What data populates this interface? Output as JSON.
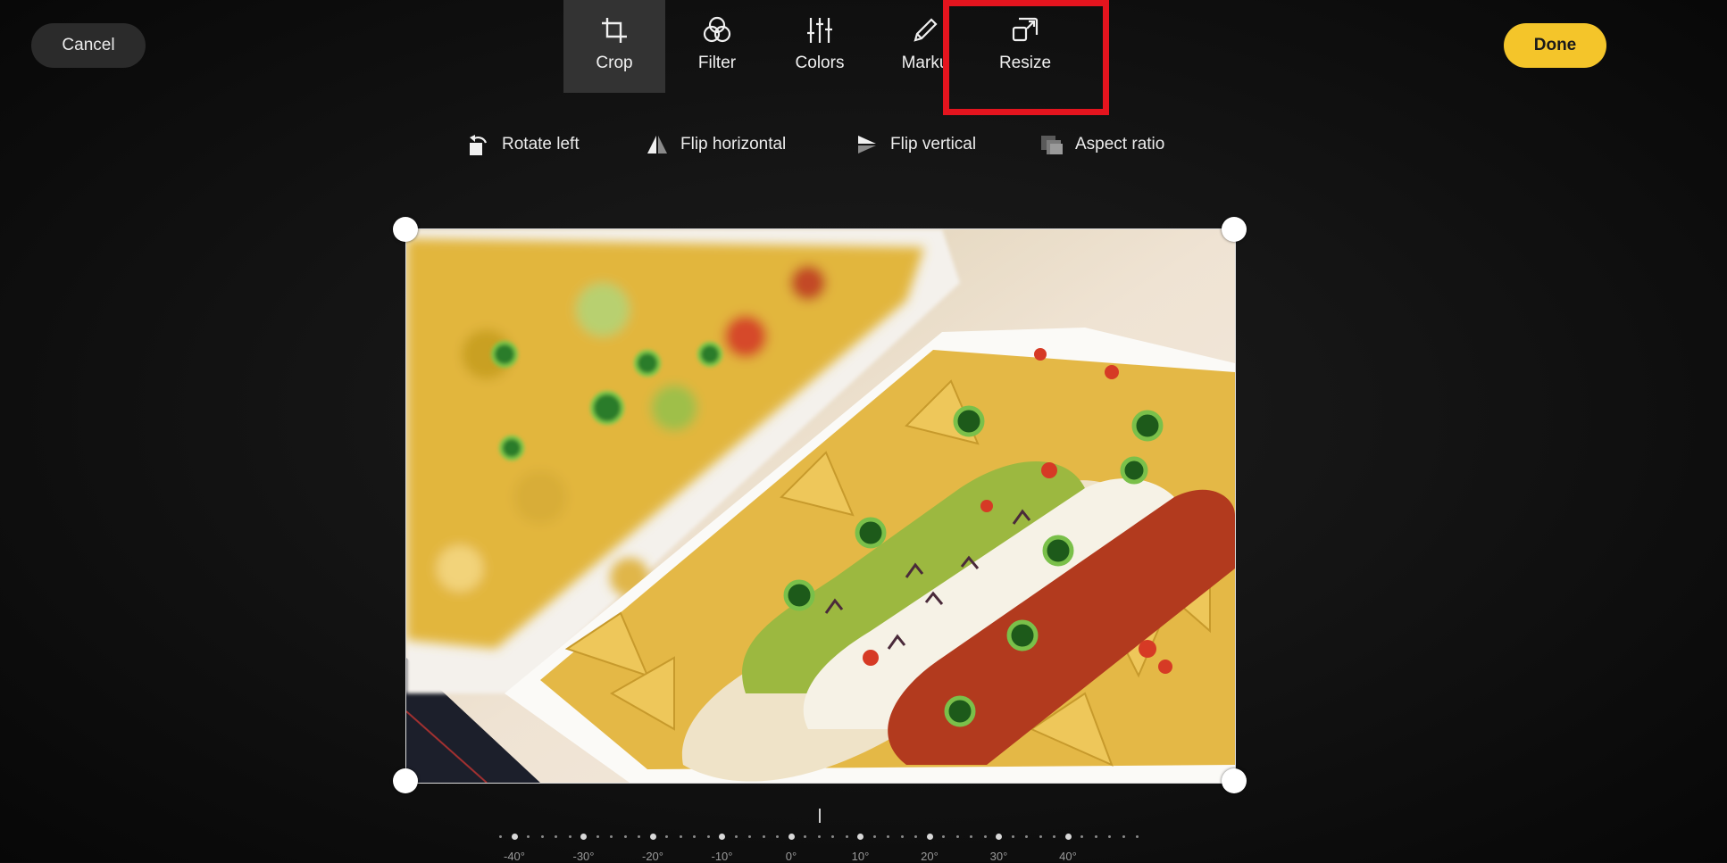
{
  "header": {
    "cancel_label": "Cancel",
    "done_label": "Done",
    "accent_color": "#f4c52a"
  },
  "tools": [
    {
      "label": "Crop",
      "icon": "crop-icon",
      "active": true
    },
    {
      "label": "Filter",
      "icon": "filter-icon",
      "active": false
    },
    {
      "label": "Colors",
      "icon": "sliders-icon",
      "active": false
    },
    {
      "label": "Marku",
      "icon": "pen-icon",
      "active": false
    },
    {
      "label": "Resize",
      "icon": "resize-icon",
      "active": false
    }
  ],
  "highlight_color": "#e4141e",
  "actions": [
    {
      "label": "Rotate left",
      "icon": "rotate-left-icon"
    },
    {
      "label": "Flip horizontal",
      "icon": "flip-horizontal-icon"
    },
    {
      "label": "Flip vertical",
      "icon": "flip-vertical-icon"
    },
    {
      "label": "Aspect ratio",
      "icon": "aspect-ratio-icon"
    }
  ],
  "ruler": {
    "labels": [
      "-40°",
      "-30°",
      "-20°",
      "-10°",
      "0°",
      "10°",
      "20°",
      "30°",
      "40°"
    ],
    "current_angle": 0
  }
}
